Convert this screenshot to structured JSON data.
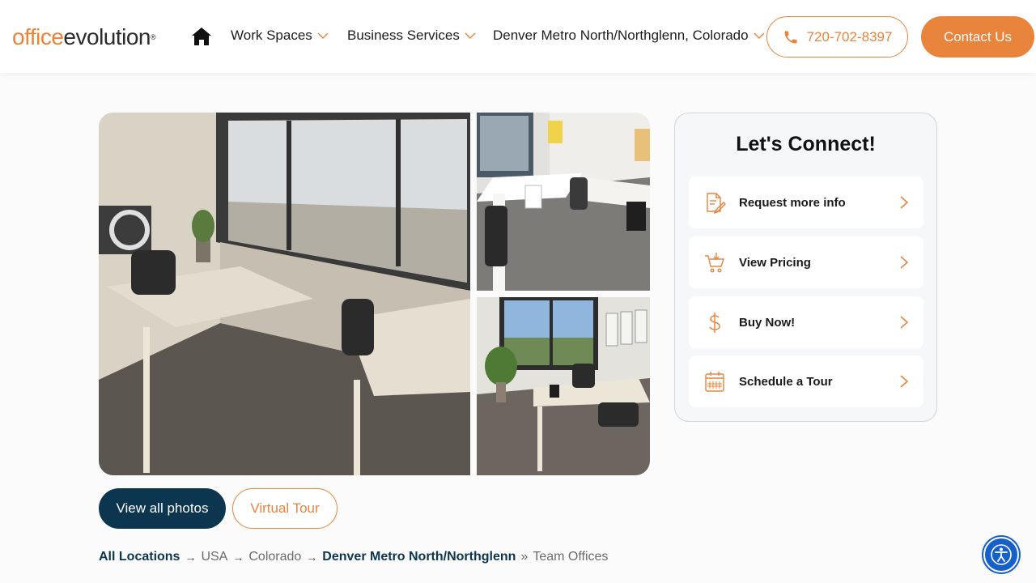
{
  "header": {
    "logo": {
      "part1": "office",
      "part2": "evolution",
      "mark": "®"
    },
    "nav": [
      {
        "label": "Work Spaces"
      },
      {
        "label": "Business Services"
      },
      {
        "label": "Denver Metro North/Northglenn, Colorado"
      }
    ],
    "phone": "720-702-8397",
    "contact_label": "Contact Us"
  },
  "gallery": {
    "view_all_label": "View all photos",
    "virtual_tour_label": "Virtual Tour"
  },
  "breadcrumb": {
    "items": [
      "All Locations",
      "USA",
      "Colorado",
      "Denver Metro North/Northglenn",
      "Team Offices"
    ],
    "separators": [
      "→",
      "→",
      "→",
      "»"
    ]
  },
  "connect": {
    "title": "Let's Connect!",
    "items": [
      {
        "label": "Request more info",
        "icon": "document-pen-icon"
      },
      {
        "label": "View Pricing",
        "icon": "cart-icon"
      },
      {
        "label": "Buy Now!",
        "icon": "dollar-icon"
      },
      {
        "label": "Schedule a Tour",
        "icon": "calendar-icon"
      }
    ]
  },
  "colors": {
    "brand_orange": "#e8843c",
    "navy": "#0c3550",
    "accessibility_blue": "#1560c9"
  }
}
